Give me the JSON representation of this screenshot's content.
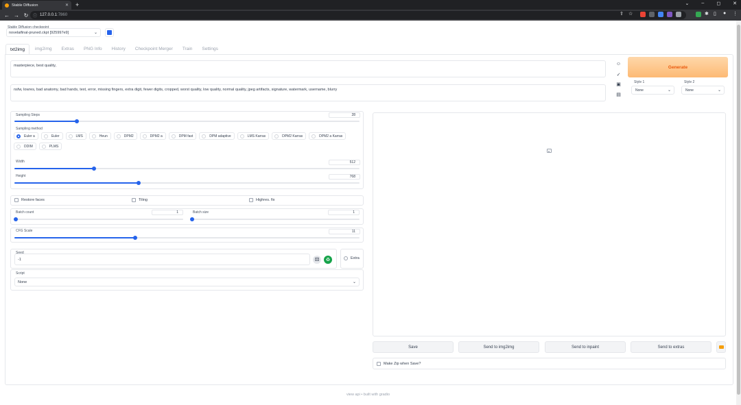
{
  "browser": {
    "tab_title": "Stable Diffusion",
    "tab_close": "✕",
    "new_tab": "+",
    "url_host": "127.0.0.1",
    "url_port": ":7860"
  },
  "checkpoint": {
    "label": "Stable Diffusion checkpoint",
    "value": "novelaifinal-pruned.ckpt [925997e9]"
  },
  "tabs": [
    "txt2img",
    "img2img",
    "Extras",
    "PNG Info",
    "History",
    "Checkpoint Merger",
    "Train",
    "Settings"
  ],
  "prompt": {
    "positive": "masterpiece, best quality,",
    "negative": "nsfw, lowres, bad anatomy, bad hands, text, error, missing fingers, extra digit, fewer digits, cropped, worst quality, low quality, normal quality, jpeg artifacts, signature, watermark, username, blurry"
  },
  "generate_label": "Generate",
  "styles": {
    "style1_label": "Style 1",
    "style1_value": "None",
    "style2_label": "Style 2",
    "style2_value": "None"
  },
  "sampling": {
    "steps_label": "Sampling Steps",
    "steps_value": "28",
    "steps_fraction": 0.18,
    "method_label": "Sampling method",
    "methods": [
      "Euler a",
      "Euler",
      "LMS",
      "Heun",
      "DPM2",
      "DPM2 a",
      "DPM fast",
      "DPM adaptive",
      "LMS Karras",
      "DPM2 Karras",
      "DPM2 a Karras",
      "DDIM",
      "PLMS"
    ],
    "selected_method": "Euler a"
  },
  "size": {
    "width_label": "Width",
    "width_value": "512",
    "width_fraction": 0.23,
    "height_label": "Height",
    "height_value": "768",
    "height_fraction": 0.36
  },
  "options": {
    "restore_faces": "Restore faces",
    "tiling": "Tiling",
    "highres_fix": "Highres. fix"
  },
  "batch": {
    "count_label": "Batch count",
    "count_value": "1",
    "size_label": "Batch size",
    "size_value": "1"
  },
  "cfg": {
    "label": "CFG Scale",
    "value": "11",
    "fraction": 0.35
  },
  "seed": {
    "label": "Seed",
    "value": "-1",
    "extra_label": "Extra"
  },
  "script": {
    "label": "Script",
    "value": "None"
  },
  "output": {
    "save": "Save",
    "send_img2img": "Send to img2img",
    "send_inpaint": "Send to inpaint",
    "send_extras": "Send to extras",
    "make_zip": "Make Zip when Save?"
  },
  "footer": "view api  •  built with gradio",
  "colors": {
    "accent": "#2563eb",
    "generate_bg": "#fdba74",
    "generate_text": "#ea580c"
  }
}
